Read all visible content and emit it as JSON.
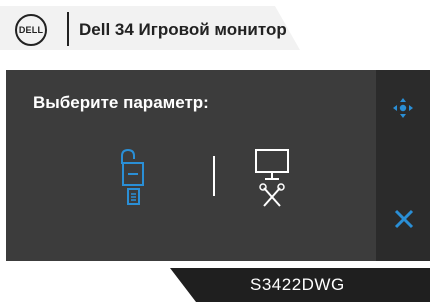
{
  "header": {
    "logo_text": "DELL",
    "title": "Dell 34 Игровой монитор"
  },
  "osd": {
    "prompt": "Выберите параметр:",
    "options": [
      {
        "icon": "unlock-menu-icon",
        "selected": true
      },
      {
        "icon": "monitor-service-icon",
        "selected": false
      }
    ],
    "nav_icon": "directional-pad-icon",
    "close_icon": "close-icon"
  },
  "footer": {
    "model": "S3422DWG"
  },
  "colors": {
    "panel_bg": "#3c3c3c",
    "side_bg": "#2b2b2b",
    "accent": "#2a8fd6",
    "text": "#ffffff"
  }
}
